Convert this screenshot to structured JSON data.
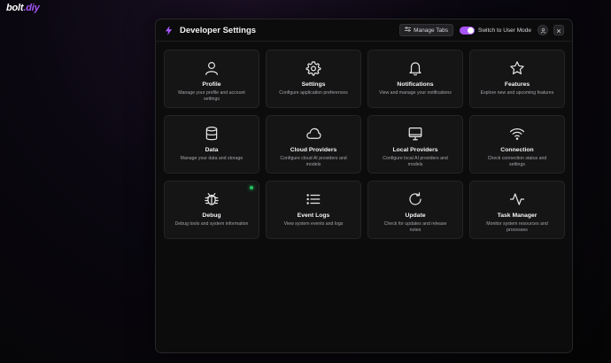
{
  "brand": {
    "name_prefix": "bolt",
    "name_suffix": ".diy",
    "accent": "#a855f7"
  },
  "dialog": {
    "title": "Developer Settings",
    "manage_tabs_label": "Manage Tabs",
    "mode_toggle_label": "Switch to User Mode",
    "mode_toggle_on": true
  },
  "tabs": [
    {
      "title": "Profile",
      "description": "Manage your profile and account settings",
      "icon": "user-icon"
    },
    {
      "title": "Settings",
      "description": "Configure application preferences",
      "icon": "gear-icon"
    },
    {
      "title": "Notifications",
      "description": "View and manage your notifications",
      "icon": "bell-icon"
    },
    {
      "title": "Features",
      "description": "Explore new and upcoming features",
      "icon": "star-icon"
    },
    {
      "title": "Data",
      "description": "Manage your data and storage",
      "icon": "database-icon"
    },
    {
      "title": "Cloud Providers",
      "description": "Configure cloud AI providers and models",
      "icon": "cloud-icon"
    },
    {
      "title": "Local Providers",
      "description": "Configure local AI providers and models",
      "icon": "monitor-icon"
    },
    {
      "title": "Connection",
      "description": "Check connection status and settings",
      "icon": "wifi-icon"
    },
    {
      "title": "Debug",
      "description": "Debug tools and system information",
      "icon": "bug-icon",
      "status": "active"
    },
    {
      "title": "Event Logs",
      "description": "View system events and logs",
      "icon": "list-icon"
    },
    {
      "title": "Update",
      "description": "Check for updates and release notes",
      "icon": "refresh-icon"
    },
    {
      "title": "Task Manager",
      "description": "Monitor system resources and processes",
      "icon": "activity-icon"
    }
  ]
}
